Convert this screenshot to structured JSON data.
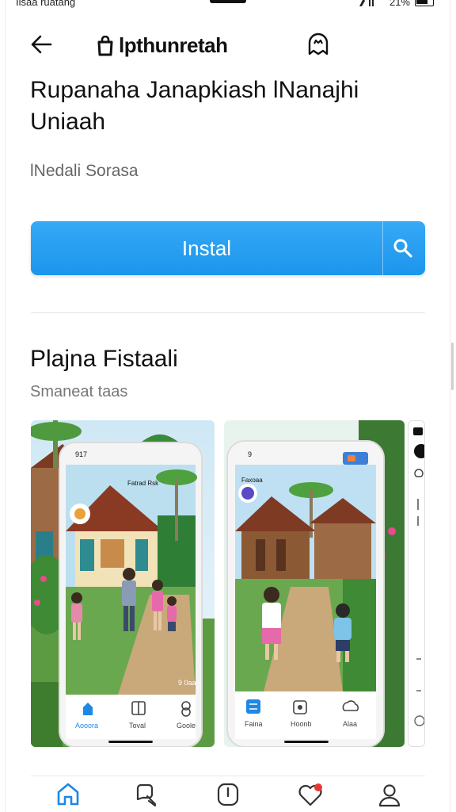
{
  "status_bar": {
    "left_text": "Ilsaa ruatang",
    "right_text": "21%"
  },
  "header": {
    "back_icon": "arrow-left-icon",
    "brand_icon": "store-bag-icon",
    "brand_title": "lpthunretah",
    "action_icon": "ghost-profile-icon"
  },
  "app": {
    "title": "Rupanaha Janapkiash lNanajhi Uniaah",
    "developer": "lNedali Sorasa"
  },
  "install_button": {
    "label": "Instal",
    "search_icon": "search-icon",
    "color": "#1c95ec"
  },
  "preview_section": {
    "title": "Plajna Fistaali",
    "subtitle": "Smaneat taas"
  },
  "screenshots": [
    {
      "status_time": "917",
      "header_text": "Fatrad Rsk",
      "caption": "9 0aa",
      "tabs": [
        "Aooora",
        "Toval",
        "Goole"
      ]
    },
    {
      "status_time": "9",
      "header_text": "Faxoaa",
      "tabs": [
        "Faina",
        "Hoonb",
        "Alaa"
      ]
    }
  ],
  "bottom_nav": [
    {
      "name": "home-icon"
    },
    {
      "name": "reviews-icon"
    },
    {
      "name": "info-icon"
    },
    {
      "name": "favorites-icon",
      "badge": true
    },
    {
      "name": "profile-icon"
    }
  ],
  "colors": {
    "accent": "#1c95ec",
    "badge": "#e53935",
    "nav_active": "#1e88e5"
  }
}
